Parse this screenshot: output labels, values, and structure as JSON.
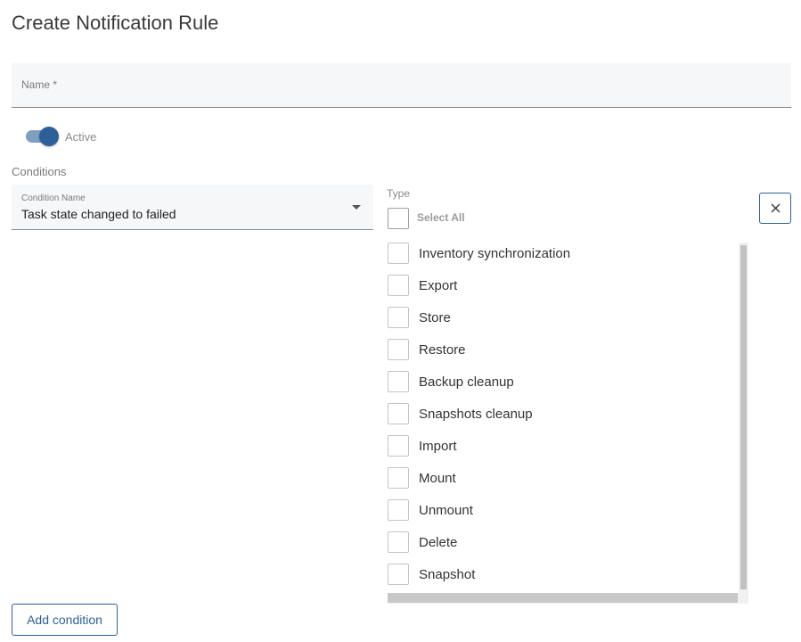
{
  "page": {
    "title": "Create Notification Rule"
  },
  "name_field": {
    "label": "Name *",
    "value": ""
  },
  "active_toggle": {
    "label": "Active",
    "checked": true
  },
  "conditions": {
    "section_label": "Conditions",
    "condition_name_label": "Condition Name",
    "condition_name_value": "Task state changed to failed"
  },
  "type_panel": {
    "label": "Type",
    "select_all_label": "Select All",
    "items": [
      {
        "label": "Inventory synchronization",
        "checked": false
      },
      {
        "label": "Export",
        "checked": false
      },
      {
        "label": "Store",
        "checked": false
      },
      {
        "label": "Restore",
        "checked": false
      },
      {
        "label": "Backup cleanup",
        "checked": false
      },
      {
        "label": "Snapshots cleanup",
        "checked": false
      },
      {
        "label": "Import",
        "checked": false
      },
      {
        "label": "Mount",
        "checked": false
      },
      {
        "label": "Unmount",
        "checked": false
      },
      {
        "label": "Delete",
        "checked": false
      },
      {
        "label": "Snapshot",
        "checked": false
      }
    ]
  },
  "actions": {
    "add_condition_label": "Add condition"
  },
  "icons": {
    "close": "close-icon",
    "dropdown": "chevron-down-icon"
  },
  "colors": {
    "accent": "#2d5f98",
    "toggle_track": "#7f9fbf",
    "field_background": "#f5f7f9"
  }
}
